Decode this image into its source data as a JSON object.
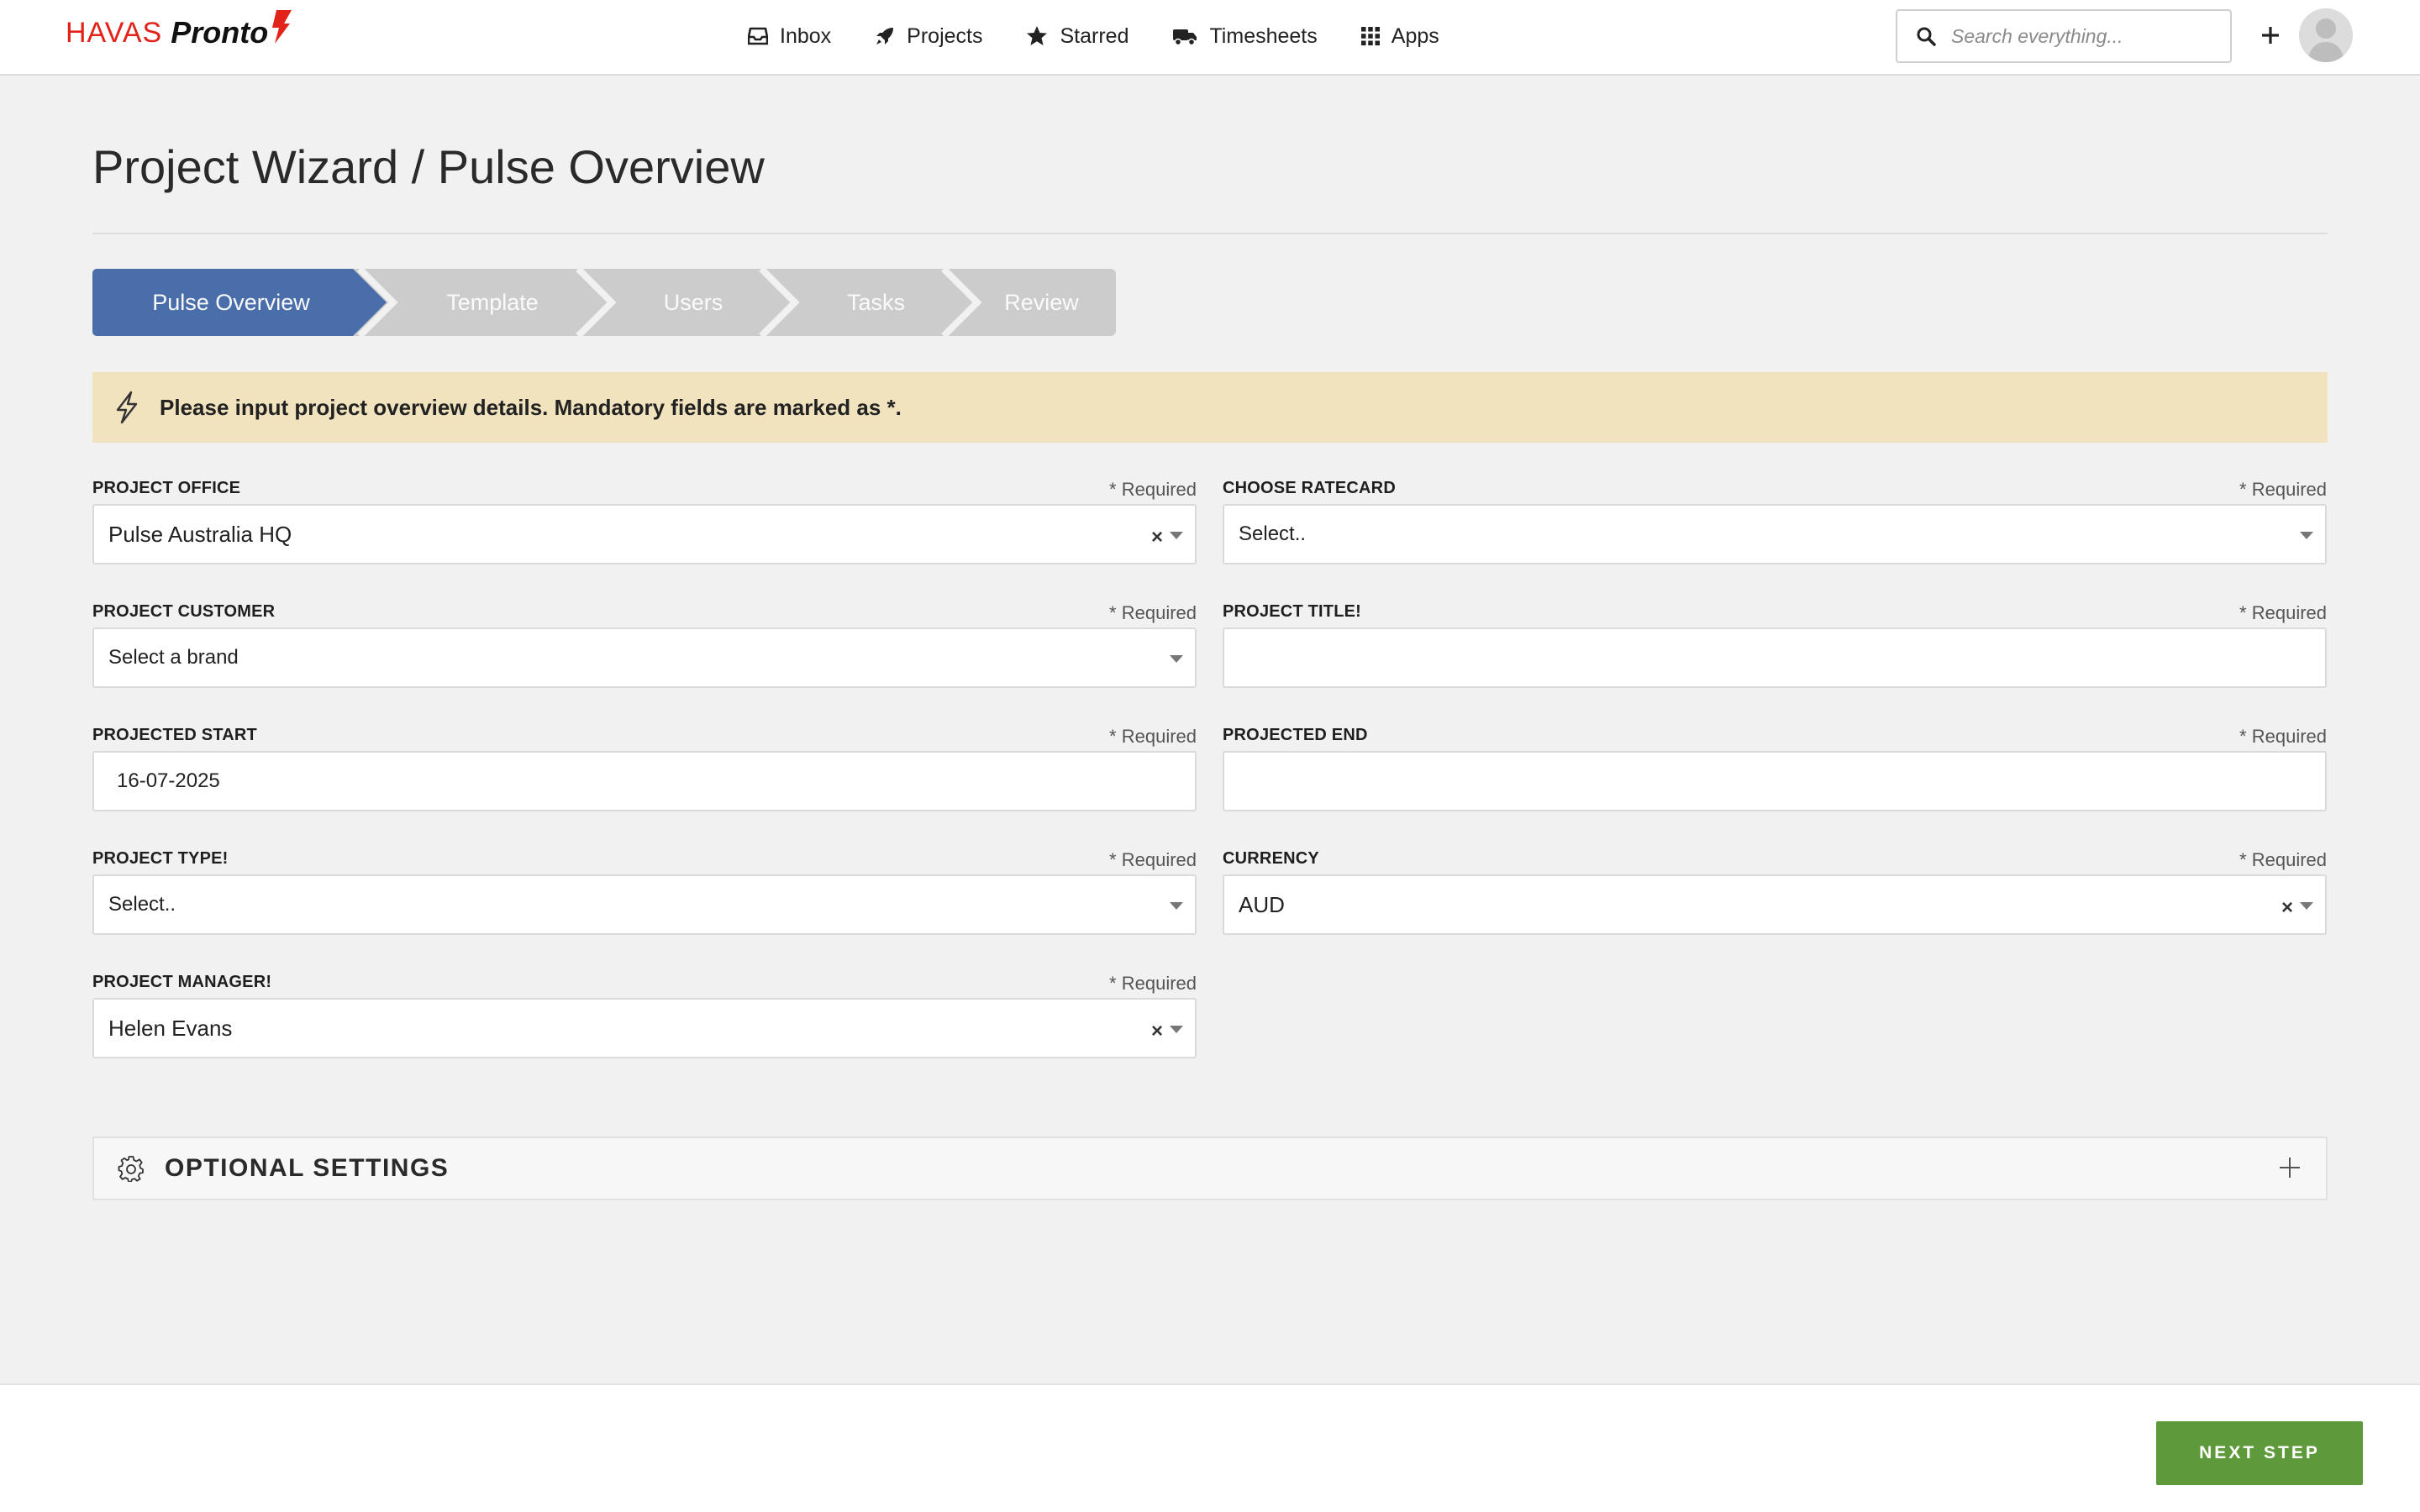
{
  "header": {
    "logo_text_1": "HAVAS",
    "logo_text_2": "Pronto",
    "nav": [
      {
        "label": "Inbox",
        "icon": "inbox-icon"
      },
      {
        "label": "Projects",
        "icon": "rocket-icon"
      },
      {
        "label": "Starred",
        "icon": "star-icon"
      },
      {
        "label": "Timesheets",
        "icon": "truck-icon"
      },
      {
        "label": "Apps",
        "icon": "grid-icon"
      }
    ],
    "search_placeholder": "Search everything..."
  },
  "page": {
    "title": "Project Wizard / Pulse Overview"
  },
  "steps": [
    {
      "label": "Pulse Overview",
      "active": true
    },
    {
      "label": "Template",
      "active": false
    },
    {
      "label": "Users",
      "active": false
    },
    {
      "label": "Tasks",
      "active": false
    },
    {
      "label": "Review",
      "active": false
    }
  ],
  "notice": {
    "text": "Please input project overview details. Mandatory fields are marked as *."
  },
  "form": {
    "required_text": "* Required",
    "project_office": {
      "label": "PROJECT OFFICE",
      "value": "Pulse Australia HQ"
    },
    "choose_ratecard": {
      "label": "CHOOSE RATECARD",
      "value": "Select.."
    },
    "project_customer": {
      "label": "PROJECT CUSTOMER",
      "value": "Select a brand"
    },
    "project_title": {
      "label": "PROJECT TITLE!",
      "value": ""
    },
    "projected_start": {
      "label": "PROJECTED START",
      "value": "16-07-2025"
    },
    "projected_end": {
      "label": "PROJECTED END",
      "value": ""
    },
    "project_type": {
      "label": "PROJECT TYPE!",
      "value": "Select.."
    },
    "currency": {
      "label": "CURRENCY",
      "value": "AUD"
    },
    "project_manager": {
      "label": "PROJECT MANAGER!",
      "value": "Helen Evans"
    }
  },
  "optional": {
    "label": "OPTIONAL SETTINGS"
  },
  "footer": {
    "next_label": "NEXT STEP"
  },
  "colors": {
    "accent_blue": "#4a6ea9",
    "step_inactive": "#cccccc",
    "notice_bg": "#f2e3bf",
    "next_green": "#5e9a3b",
    "logo_red": "#e2231a"
  }
}
